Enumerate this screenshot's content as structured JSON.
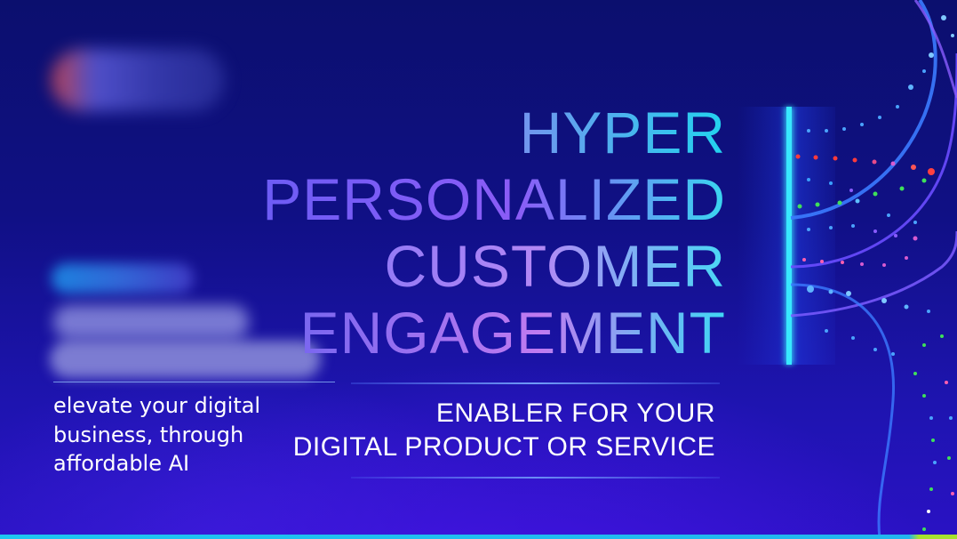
{
  "headline": {
    "line1": "HYPER",
    "line2": "PERSONALIZED",
    "line3": "CUSTOMER",
    "line4": "ENGAGEMENT"
  },
  "subheadline": {
    "line1": "ENABLER FOR YOUR",
    "line2": "DIGITAL PRODUCT OR SERVICE"
  },
  "tagline": {
    "line1": "elevate your digital",
    "line2": "business, through",
    "line3": "affordable AI"
  },
  "colors": {
    "background_top": "#0b0f6e",
    "background_bottom": "#2a12c4",
    "accent_cyan": "#22d3ee",
    "accent_magenta": "#d946ef",
    "bottom_bar": "#1ec6f0"
  }
}
